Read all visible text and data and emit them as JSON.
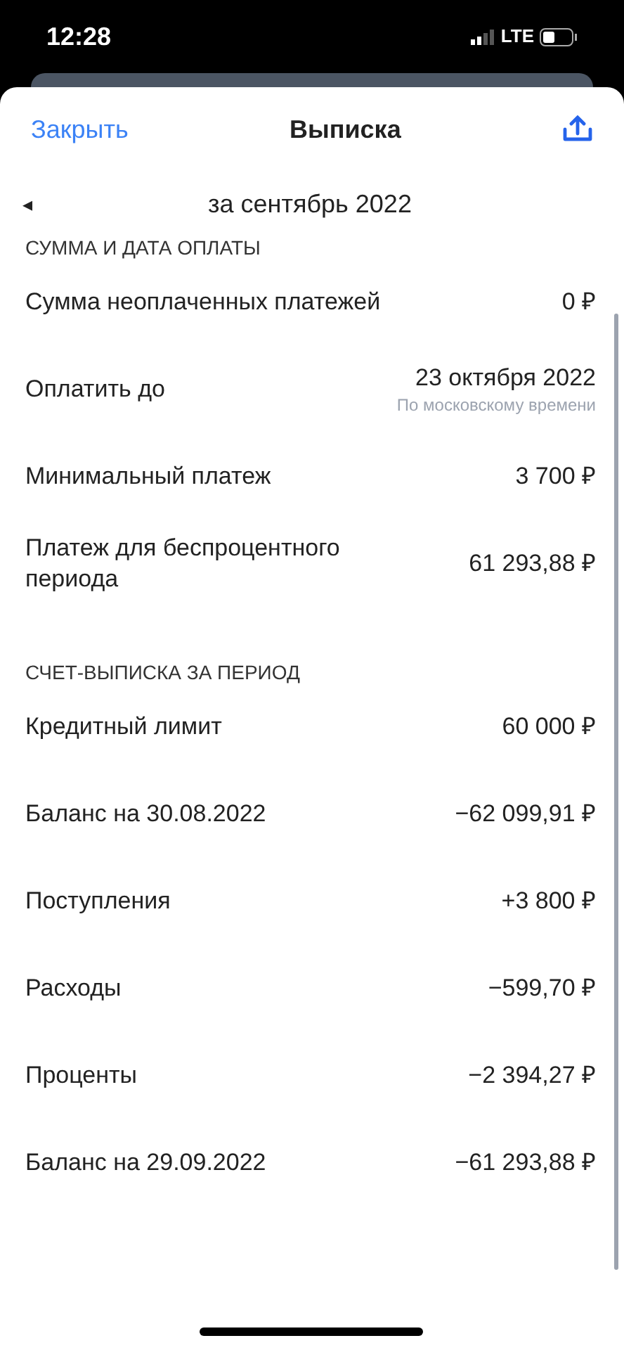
{
  "status_bar": {
    "time": "12:28",
    "network": "LTE"
  },
  "header": {
    "close": "Закрыть",
    "title": "Выписка"
  },
  "period": {
    "arrow": "◂",
    "label": "за сентябрь 2022"
  },
  "sections": [
    {
      "title": "СУММА И ДАТА ОПЛАТЫ",
      "rows": [
        {
          "label": "Сумма неоплаченных платежей",
          "value": "0 ₽"
        },
        {
          "label": "Оплатить до",
          "value": "23 октября 2022",
          "note": "По московскому времени"
        },
        {
          "label": "Минимальный платеж",
          "value": "3 700 ₽"
        },
        {
          "label": "Платеж для беспроцентного периода",
          "value": "61 293,88 ₽"
        }
      ]
    },
    {
      "title": "СЧЕТ-ВЫПИСКА ЗА ПЕРИОД",
      "rows": [
        {
          "label": "Кредитный лимит",
          "value": "60 000 ₽"
        },
        {
          "label": "Баланс на 30.08.2022",
          "value": "−62 099,91 ₽"
        },
        {
          "label": "Поступления",
          "value": "+3 800 ₽"
        },
        {
          "label": "Расходы",
          "value": "−599,70 ₽"
        },
        {
          "label": "Проценты",
          "value": "−2 394,27 ₽"
        },
        {
          "label": "Баланс на 29.09.2022",
          "value": "−61 293,88 ₽"
        }
      ]
    }
  ]
}
